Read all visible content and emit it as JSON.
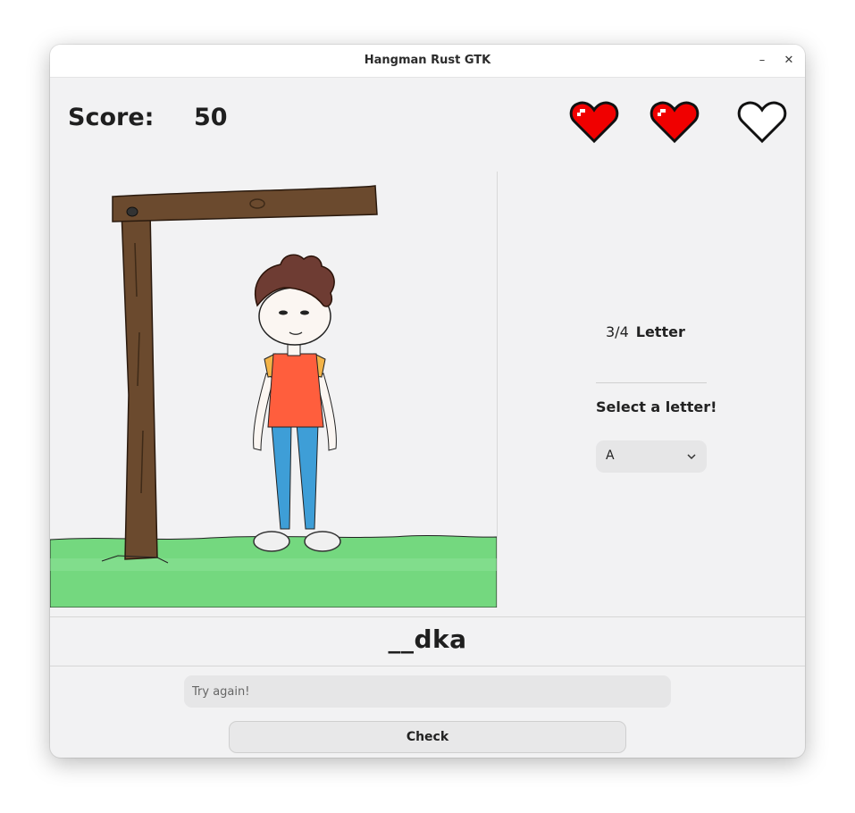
{
  "window": {
    "title": "Hangman Rust GTK",
    "minimize_glyph": "–",
    "close_glyph": "✕"
  },
  "score": {
    "label": "Score:",
    "value": "50"
  },
  "lives": {
    "total": 3,
    "remaining": 2,
    "full_color": "#f00000",
    "empty_color": "#ffffff"
  },
  "progress": {
    "count": "3/4",
    "label": "Letter"
  },
  "letter_select": {
    "label": "Select a letter!",
    "value": "A"
  },
  "word": "__dka",
  "guess_input": {
    "placeholder": "Try again!",
    "value": ""
  },
  "check_button": {
    "label": "Check"
  },
  "colors": {
    "accent_heart": "#f00000",
    "grass": "#74d87f",
    "shirt": "#ff5e3d",
    "pants": "#3e9ed7",
    "wood": "#6b4a2e"
  }
}
